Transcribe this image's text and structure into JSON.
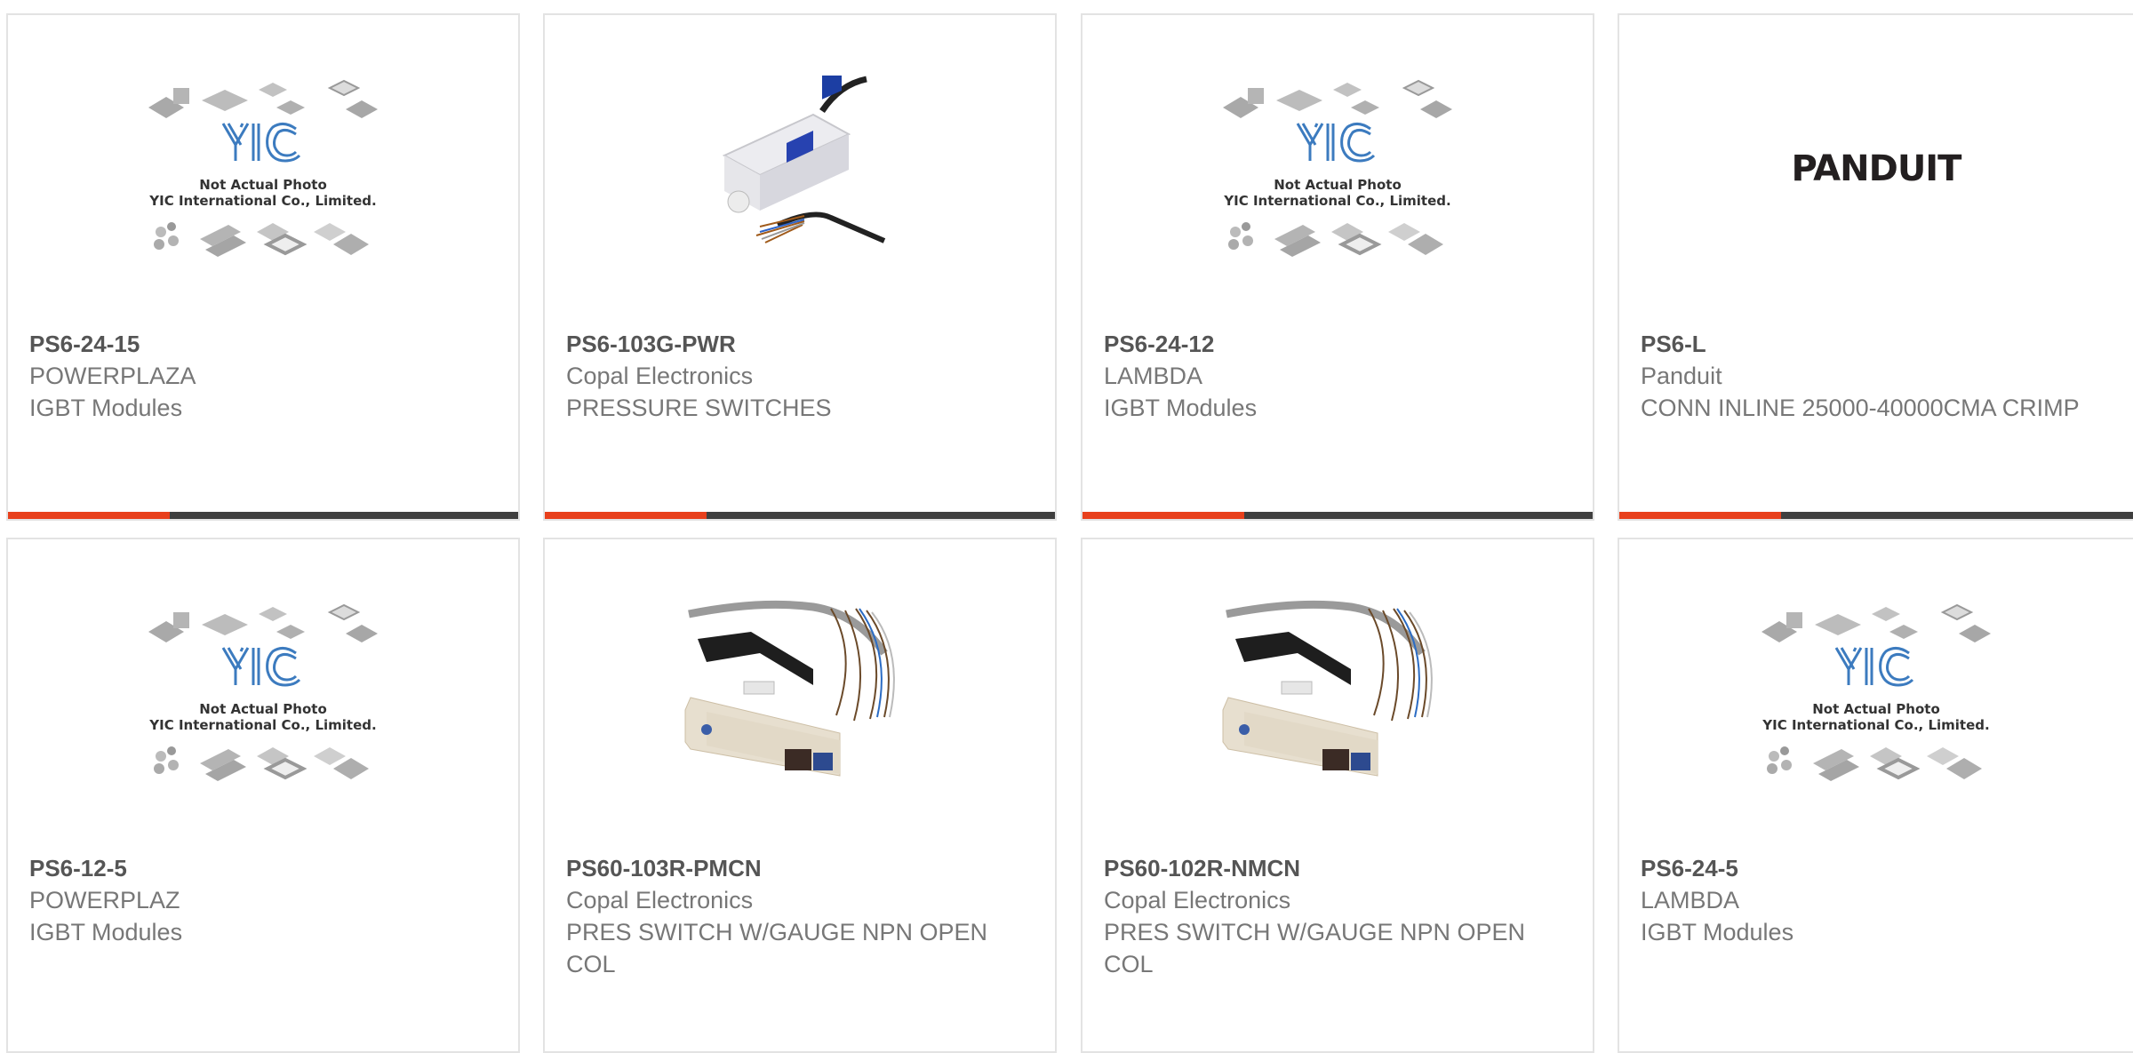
{
  "colors": {
    "accent": "#e8401c",
    "bar": "#3f3f3f",
    "border": "#e3e3e3"
  },
  "placeholder": {
    "line1": "Not Actual Photo",
    "line2": "YIC International Co., Limited.",
    "logo": "YIC"
  },
  "panduit_logo": "PANDUIT",
  "products": [
    {
      "part": "PS6-24-15",
      "manufacturer": "POWERPLAZA",
      "description": "IGBT Modules",
      "image": "yic-placeholder"
    },
    {
      "part": "PS6-103G-PWR",
      "manufacturer": "Copal Electronics",
      "description": "PRESSURE SWITCHES",
      "image": "pressure-switch-photo"
    },
    {
      "part": "PS6-24-12",
      "manufacturer": "LAMBDA",
      "description": "IGBT Modules",
      "image": "yic-placeholder"
    },
    {
      "part": "PS6-L",
      "manufacturer": "Panduit",
      "description": "CONN INLINE 25000-40000CMA CRIMP",
      "image": "panduit-logo"
    },
    {
      "part": "PS6-12-5",
      "manufacturer": "POWERPLAZ",
      "description": "IGBT Modules",
      "image": "yic-placeholder"
    },
    {
      "part": "PS60-103R-PMCN",
      "manufacturer": "Copal Electronics",
      "description": "PRES SWITCH W/GAUGE NPN OPEN COL",
      "image": "sensor-photo"
    },
    {
      "part": "PS60-102R-NMCN",
      "manufacturer": "Copal Electronics",
      "description": "PRES SWITCH W/GAUGE NPN OPEN COL",
      "image": "sensor-photo"
    },
    {
      "part": "PS6-24-5",
      "manufacturer": "LAMBDA",
      "description": "IGBT Modules",
      "image": "yic-placeholder"
    }
  ]
}
